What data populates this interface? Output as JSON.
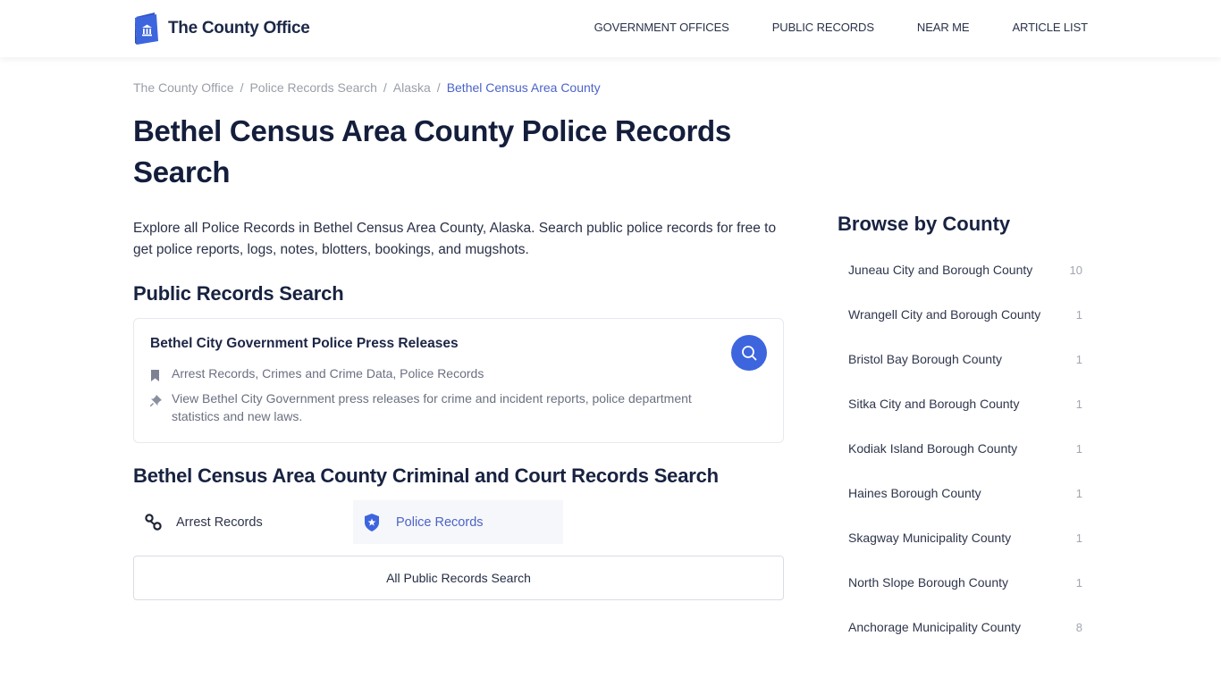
{
  "header": {
    "logo_text": "The County Office",
    "nav": [
      "GOVERNMENT OFFICES",
      "PUBLIC RECORDS",
      "NEAR ME",
      "ARTICLE LIST"
    ]
  },
  "breadcrumb": {
    "items": [
      "The County Office",
      "Police Records Search",
      "Alaska"
    ],
    "current": "Bethel Census Area County",
    "separator": "/"
  },
  "page": {
    "title": "Bethel Census Area County Police Records Search",
    "intro": "Explore all Police Records in Bethel Census Area County, Alaska. Search public police records for free to get police reports, logs, notes, blotters, bookings, and mugshots."
  },
  "public_records": {
    "heading": "Public Records Search",
    "card": {
      "title": "Bethel City Government Police Press Releases",
      "tags": "Arrest Records, Crimes and Crime Data, Police Records",
      "description": "View Bethel City Government press releases for crime and incident reports, police department statistics and new laws.",
      "search_icon": "search-icon"
    }
  },
  "criminal": {
    "heading": "Bethel Census Area County Criminal and Court Records Search",
    "items": [
      {
        "label": "Arrest Records",
        "icon": "handcuffs-icon",
        "active": false
      },
      {
        "label": "Police Records",
        "icon": "police-badge-icon",
        "active": true
      }
    ],
    "all_button": "All Public Records Search"
  },
  "sidebar": {
    "title": "Browse by County",
    "counties": [
      {
        "name": "Juneau City and Borough County",
        "count": "10"
      },
      {
        "name": "Wrangell City and Borough County",
        "count": "1"
      },
      {
        "name": "Bristol Bay Borough County",
        "count": "1"
      },
      {
        "name": "Sitka City and Borough County",
        "count": "1"
      },
      {
        "name": "Kodiak Island Borough County",
        "count": "1"
      },
      {
        "name": "Haines Borough County",
        "count": "1"
      },
      {
        "name": "Skagway Municipality County",
        "count": "1"
      },
      {
        "name": "North Slope Borough County",
        "count": "1"
      },
      {
        "name": "Anchorage Municipality County",
        "count": "8"
      }
    ]
  },
  "colors": {
    "accent": "#3d65de",
    "link_active": "#4b63c9",
    "heading": "#141e3c"
  }
}
